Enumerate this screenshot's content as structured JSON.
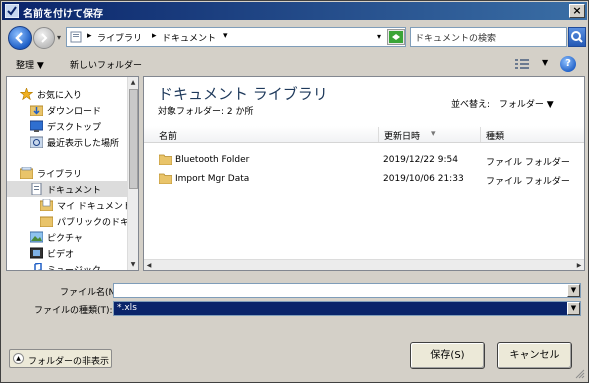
{
  "window": {
    "title": "名前を付けて保存",
    "close_label": "×"
  },
  "navbar": {
    "breadcrumb": [
      "ライブラリ",
      "ドキュメント"
    ],
    "separator": "▸",
    "drop_arrow": "▾",
    "search_placeholder": "ドキュメントの検索"
  },
  "toolbar": {
    "organize": "整理 ▼",
    "new_folder": "新しいフォルダー",
    "views_drop": "▼",
    "help": "?"
  },
  "nav_tree": [
    {
      "label": "お気に入り",
      "icon": "star-icon",
      "selected": false
    },
    {
      "label": "ダウンロード",
      "icon": "download-folder-icon",
      "selected": false
    },
    {
      "label": "デスクトップ",
      "icon": "desktop-icon",
      "selected": false
    },
    {
      "label": "最近表示した場所",
      "icon": "recent-places-icon",
      "selected": false
    },
    {
      "label": "ライブラリ",
      "icon": "library-icon",
      "selected": false
    },
    {
      "label": "ドキュメント",
      "icon": "documents-icon",
      "selected": true
    },
    {
      "label": "マイ ドキュメント",
      "icon": "document-folder-icon",
      "selected": false
    },
    {
      "label": "パブリックのドキュメ",
      "icon": "folder-icon",
      "selected": false
    },
    {
      "label": "ピクチャ",
      "icon": "pictures-icon",
      "selected": false
    },
    {
      "label": "ビデオ",
      "icon": "video-icon",
      "selected": false
    },
    {
      "label": "ミュージック",
      "icon": "music-icon",
      "selected": false
    }
  ],
  "library": {
    "title": "ドキュメント ライブラリ",
    "subtitle": "対象フォルダー:  2 か所",
    "sort_label": "並べ替え:",
    "sort_value": "フォルダー ▼"
  },
  "columns": {
    "name": "名前",
    "modified": "更新日時",
    "type": "種類",
    "sort_arrow": "▾"
  },
  "files": [
    {
      "name": "Bluetooth Folder",
      "modified": "2019/12/22 9:54",
      "type": "ファイル フォルダー"
    },
    {
      "name": "Import Mgr Data",
      "modified": "2019/10/06 21:33",
      "type": "ファイル フォルダー"
    }
  ],
  "form": {
    "filename_label": "ファイル名(N):",
    "filename_value": "",
    "filetype_label": "ファイルの種類(T):",
    "filetype_value": "*.xls"
  },
  "buttons": {
    "hide_folders": "フォルダーの非表示",
    "save": "保存(S)",
    "cancel": "キャンセル"
  },
  "colors": {
    "title_start": "#0a246a",
    "title_end": "#3a6ea5",
    "selection": "#0a246a",
    "face": "#d4d0c8"
  }
}
